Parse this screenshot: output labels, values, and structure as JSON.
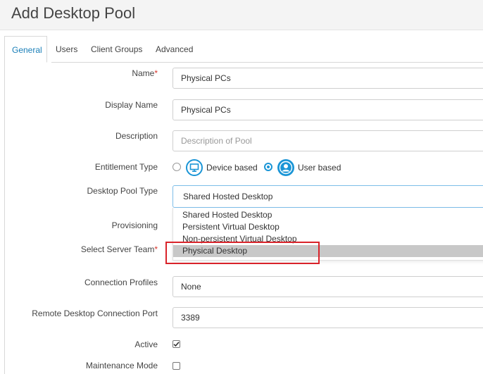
{
  "window": {
    "title": "Add Desktop Pool"
  },
  "tabs": [
    {
      "label": "General",
      "active": true
    },
    {
      "label": "Users"
    },
    {
      "label": "Client Groups"
    },
    {
      "label": "Advanced"
    }
  ],
  "form": {
    "name": {
      "label": "Name",
      "required_mark": "*",
      "value": "Physical PCs"
    },
    "display_name": {
      "label": "Display Name",
      "value": "Physical PCs"
    },
    "description": {
      "label": "Description",
      "placeholder": "Description of Pool"
    },
    "entitlement_type": {
      "label": "Entitlement Type",
      "options": [
        {
          "label": "Device based",
          "icon": "monitor-icon",
          "checked": false
        },
        {
          "label": "User based",
          "icon": "user-icon",
          "checked": true
        }
      ]
    },
    "desktop_pool_type": {
      "label": "Desktop Pool Type",
      "value": "Shared Hosted Desktop",
      "options": [
        "Shared Hosted Desktop",
        "Persistent Virtual Desktop",
        "Non-persistent Virtual Desktop",
        "Physical Desktop"
      ],
      "highlighted_option": "Physical Desktop"
    },
    "provisioning": {
      "label": "Provisioning"
    },
    "server_team": {
      "label": "Select Server Team",
      "required_mark": "*"
    },
    "connection_profiles": {
      "label": "Connection Profiles",
      "value": "None"
    },
    "rdp_port": {
      "label": "Remote Desktop Connection Port",
      "value": "3389"
    },
    "active": {
      "label": "Active",
      "checked": true
    },
    "maintenance_mode": {
      "label": "Maintenance Mode",
      "checked": false
    }
  },
  "colors": {
    "accent": "#1a95d6",
    "required": "#d9342b",
    "annotation": "#d9232a",
    "selected_option_bg": "#c8c8c8"
  }
}
